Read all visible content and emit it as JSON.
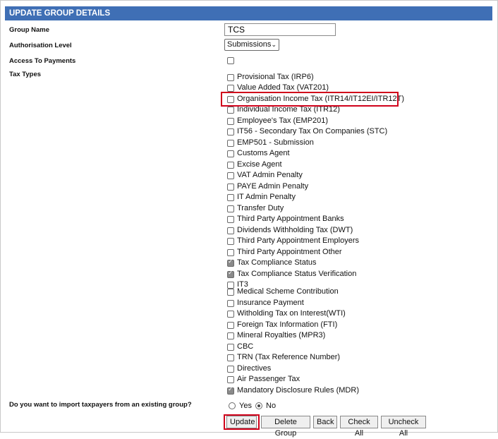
{
  "header": {
    "title": "UPDATE GROUP DETAILS"
  },
  "form": {
    "group_name_label": "Group Name",
    "group_name_value": "TCS",
    "auth_level_label": "Authorisation Level",
    "auth_level_value": "Submissions",
    "access_payments_label": "Access To Payments",
    "tax_types_label": "Tax Types",
    "import_label": "Do you want to import taxpayers from an existing group?",
    "import_options": [
      {
        "label": "Yes",
        "selected": false
      },
      {
        "label": "No",
        "selected": true
      }
    ]
  },
  "tax_types": [
    {
      "label": "Provisional Tax (IRP6)",
      "checked": false
    },
    {
      "label": "Value Added Tax (VAT201)",
      "checked": false
    },
    {
      "label": "Organisation Income Tax (ITR14/IT12EI/ITR12T)",
      "checked": false
    },
    {
      "label": "Individual Income Tax (ITR12)",
      "checked": false
    },
    {
      "label": "Employee's Tax (EMP201)",
      "checked": false
    },
    {
      "label": "IT56 - Secondary Tax On Companies (STC)",
      "checked": false
    },
    {
      "label": "EMP501 - Submission",
      "checked": false
    },
    {
      "label": "Customs Agent",
      "checked": false
    },
    {
      "label": "Excise Agent",
      "checked": false
    },
    {
      "label": "VAT Admin Penalty",
      "checked": false
    },
    {
      "label": "PAYE Admin Penalty",
      "checked": false
    },
    {
      "label": "IT Admin Penalty",
      "checked": false
    },
    {
      "label": "Transfer Duty",
      "checked": false
    },
    {
      "label": "Third Party Appointment Banks",
      "checked": false
    },
    {
      "label": "Dividends Withholding Tax (DWT)",
      "checked": false
    },
    {
      "label": "Third Party Appointment Employers",
      "checked": false
    },
    {
      "label": "Third Party Appointment Other",
      "checked": false
    },
    {
      "label": "Tax Compliance Status",
      "checked": true
    },
    {
      "label": "Tax Compliance Status Verification",
      "checked": true
    },
    {
      "label": "IT3",
      "checked": false
    },
    {
      "label": "Medical Scheme Contribution",
      "checked": false
    },
    {
      "label": "Insurance Payment",
      "checked": false
    },
    {
      "label": "Witholding Tax on Interest(WTI)",
      "checked": false
    },
    {
      "label": "Foreign Tax Information (FTI)",
      "checked": false
    },
    {
      "label": "Mineral Royalties (MPR3)",
      "checked": false
    },
    {
      "label": "CBC",
      "checked": false
    },
    {
      "label": "TRN (Tax Reference Number)",
      "checked": false
    },
    {
      "label": "Directives",
      "checked": false
    },
    {
      "label": "Air Passenger Tax",
      "checked": false
    },
    {
      "label": "Mandatory Disclosure Rules (MDR)",
      "checked": true
    }
  ],
  "buttons": {
    "update": "Update",
    "delete_group": "Delete Group",
    "back": "Back",
    "check_all": "Check All",
    "uncheck_all": "Uncheck All"
  },
  "colors": {
    "header_bg": "#3f6fb5",
    "highlight": "#d0021b"
  }
}
